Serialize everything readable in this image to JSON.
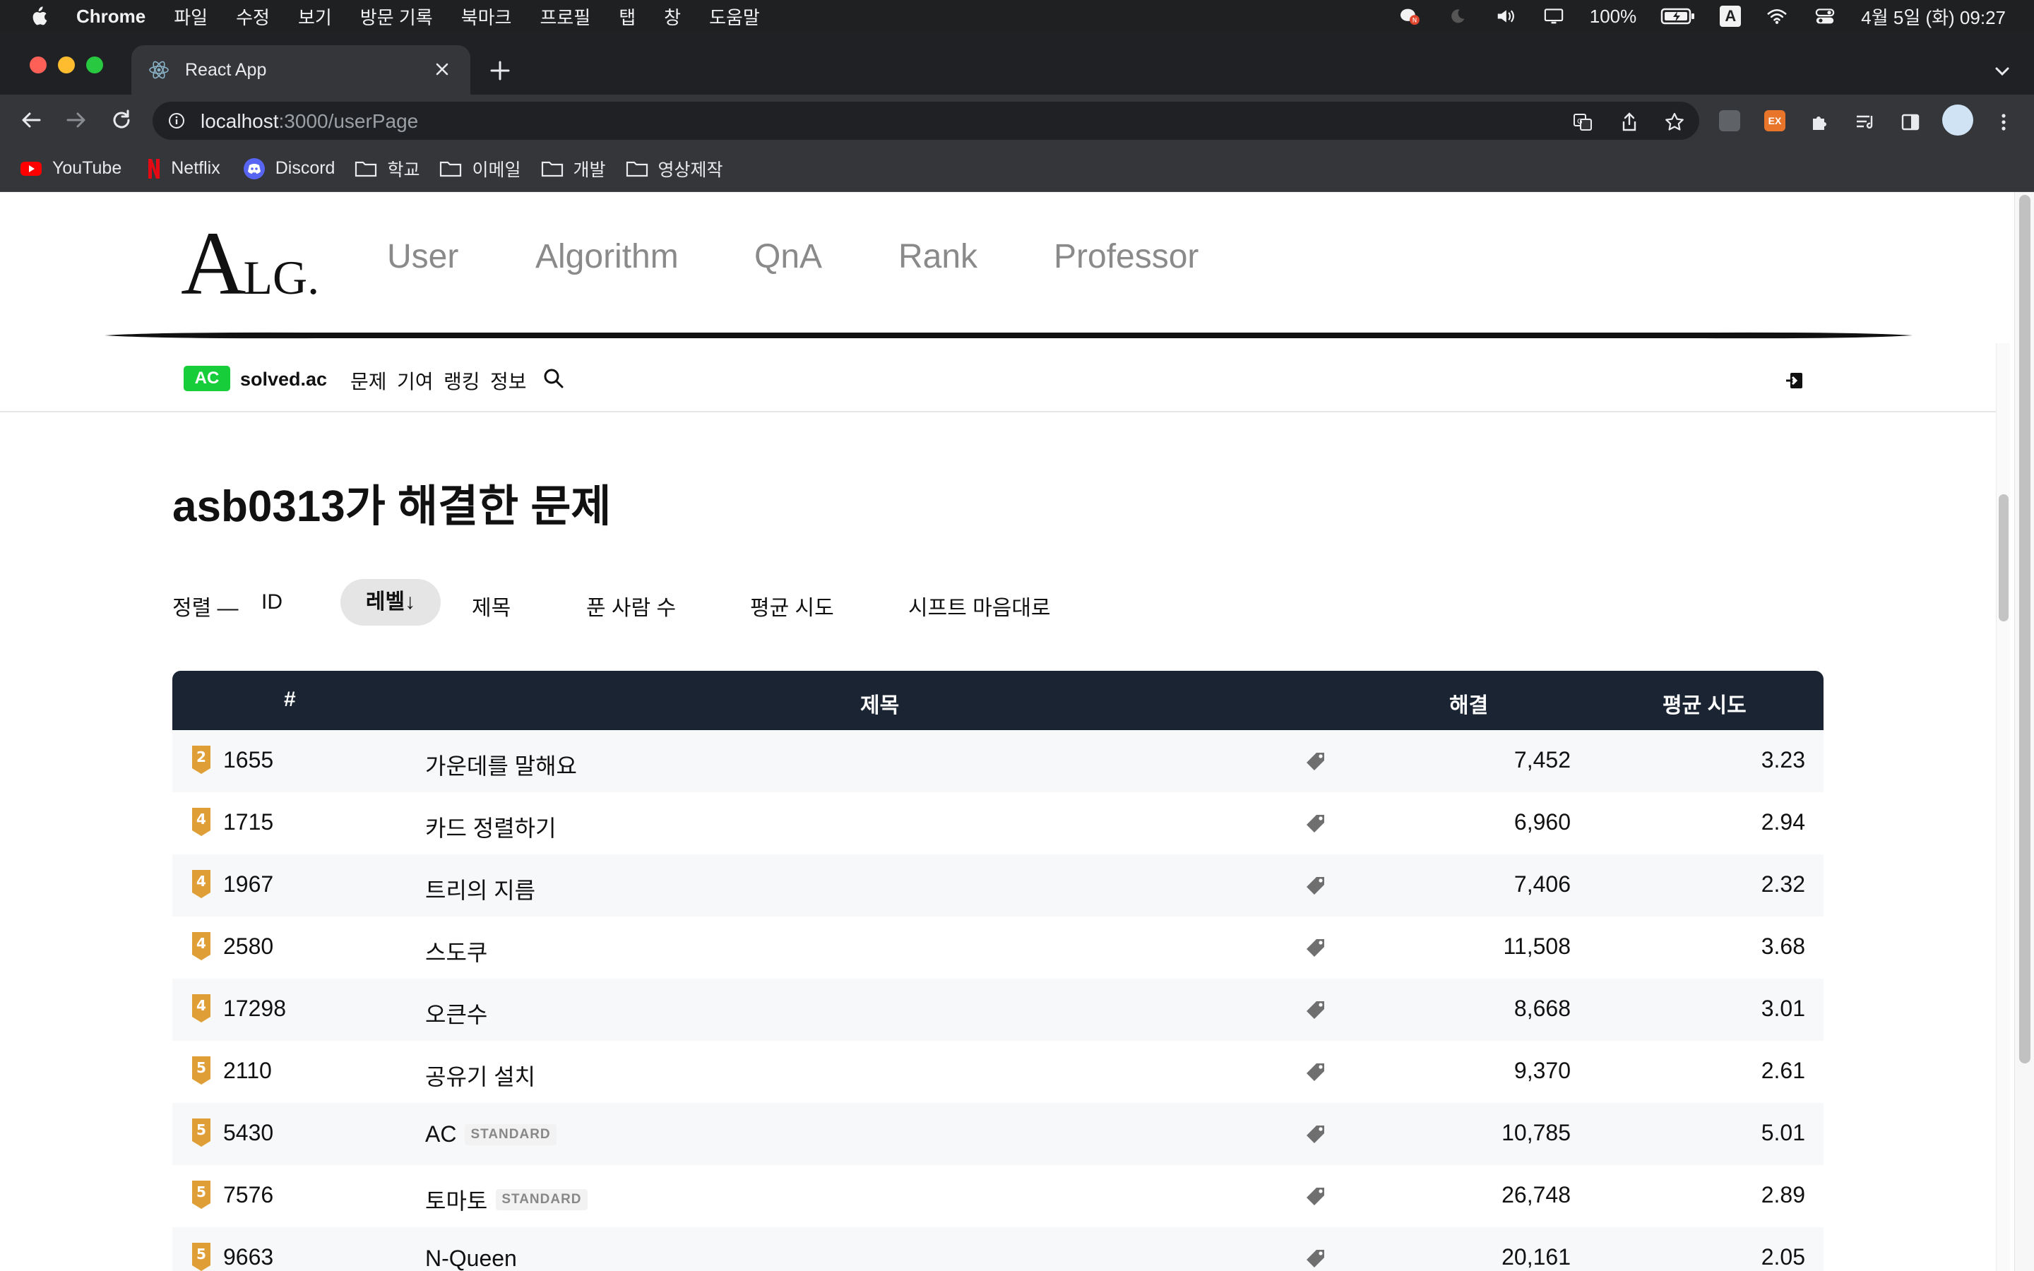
{
  "menubar": {
    "app": "Chrome",
    "items": [
      "파일",
      "수정",
      "보기",
      "방문 기록",
      "북마크",
      "프로필",
      "탭",
      "창",
      "도움말"
    ],
    "battery": "100%",
    "input_source": "A",
    "clock": "4월 5일 (화) 09:27"
  },
  "browser": {
    "tab_title": "React App",
    "url_host": "localhost",
    "url_path": ":3000/userPage",
    "bookmarks": [
      "YouTube",
      "Netflix",
      "Discord",
      "학교",
      "이메일",
      "개발",
      "영상제작"
    ],
    "ext_label": "EX"
  },
  "site": {
    "logo_big": "A",
    "logo_small": "LG.",
    "nav": [
      "User",
      "Algorithm",
      "QnA",
      "Rank",
      "Professor"
    ]
  },
  "solved": {
    "badge": "AC",
    "name": "solved.ac",
    "menu": [
      "문제",
      "기여",
      "랭킹",
      "정보"
    ]
  },
  "main": {
    "heading": "asb0313가 해결한 문제",
    "sort_label": "정렬 —",
    "sort_options": [
      "ID",
      "레벨↓",
      "제목",
      "푼 사람 수",
      "평균 시도",
      "시프트 마음대로"
    ],
    "columns": [
      "#",
      "제목",
      "해결",
      "평균 시도"
    ],
    "rows": [
      {
        "level": "2",
        "id": "1655",
        "title": "가운데를 말해요",
        "tag": "",
        "solved": "7,452",
        "avg": "3.23"
      },
      {
        "level": "4",
        "id": "1715",
        "title": "카드 정렬하기",
        "tag": "",
        "solved": "6,960",
        "avg": "2.94"
      },
      {
        "level": "4",
        "id": "1967",
        "title": "트리의 지름",
        "tag": "",
        "solved": "7,406",
        "avg": "2.32"
      },
      {
        "level": "4",
        "id": "2580",
        "title": "스도쿠",
        "tag": "",
        "solved": "11,508",
        "avg": "3.68"
      },
      {
        "level": "4",
        "id": "17298",
        "title": "오큰수",
        "tag": "",
        "solved": "8,668",
        "avg": "3.01"
      },
      {
        "level": "5",
        "id": "2110",
        "title": "공유기 설치",
        "tag": "",
        "solved": "9,370",
        "avg": "2.61"
      },
      {
        "level": "5",
        "id": "5430",
        "title": "AC",
        "tag": "STANDARD",
        "solved": "10,785",
        "avg": "5.01"
      },
      {
        "level": "5",
        "id": "7576",
        "title": "토마토",
        "tag": "STANDARD",
        "solved": "26,748",
        "avg": "2.89"
      },
      {
        "level": "5",
        "id": "9663",
        "title": "N-Queen",
        "tag": "",
        "solved": "20,161",
        "avg": "2.05"
      }
    ]
  },
  "colors": {
    "tier_gold": "#e09e37",
    "ac_green": "#17ce3a",
    "table_header": "#1b2432"
  },
  "icons": {
    "row_tag": "tag-icon",
    "search": "search-icon",
    "login": "login-icon"
  }
}
